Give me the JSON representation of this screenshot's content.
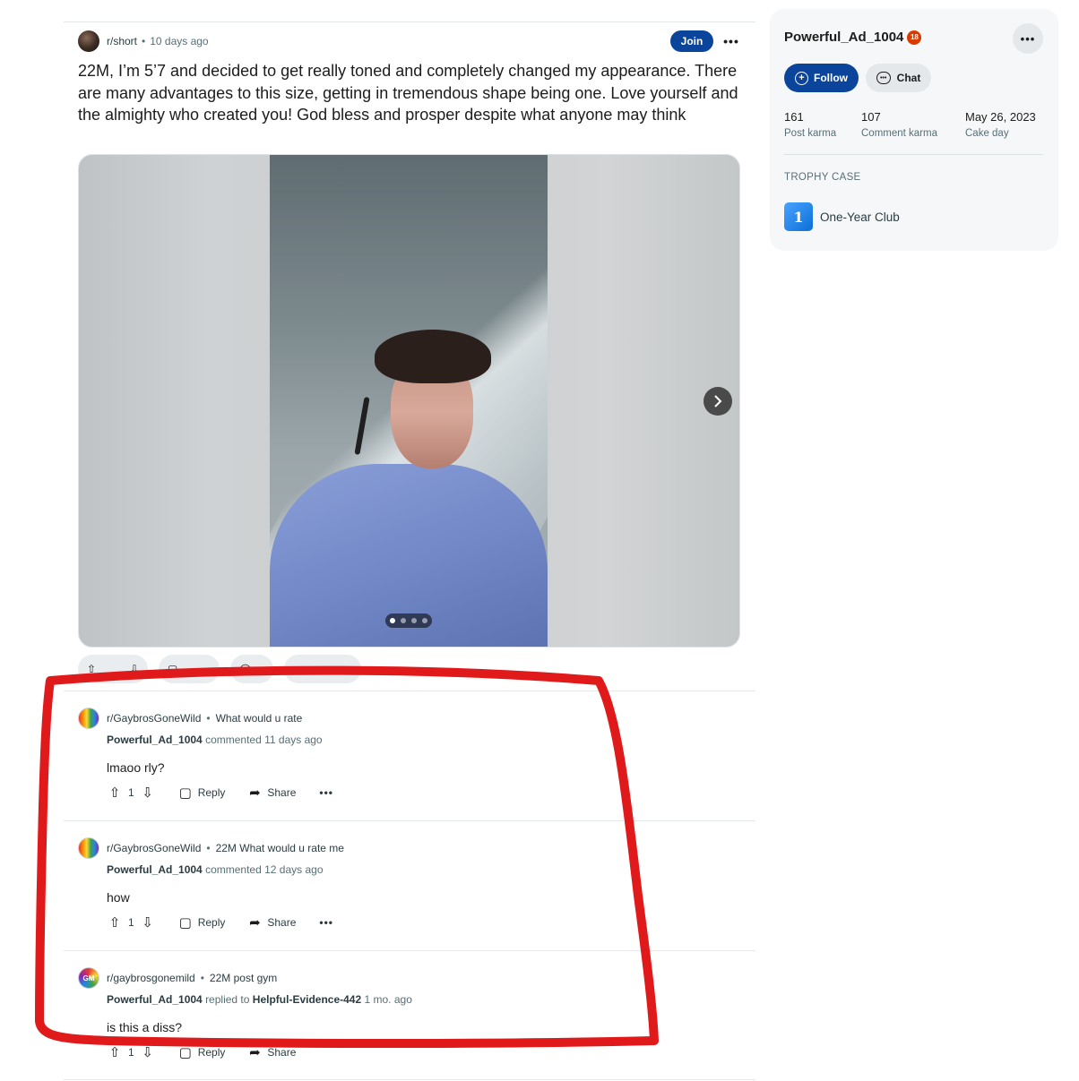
{
  "post": {
    "subreddit": "r/short",
    "age": "10 days ago",
    "join_label": "Join",
    "more_label": "•••",
    "title": "22M, I’m 5’7 and decided to get really toned and completely changed my appearance. There are many advantages to this size, getting in tremendous shape being one. Love yourself and the almighty who created you! God bless and prosper despite what anyone may think",
    "gallery": {
      "current": 1,
      "total": 4
    },
    "next_icon": "chevron-right-icon"
  },
  "comments": [
    {
      "subreddit": "r/GaybrosGoneWild",
      "post_title": "What would u rate",
      "author": "Powerful_Ad_1004",
      "action": "commented",
      "target": "",
      "age": "11 days ago",
      "body": "lmaoo rly?",
      "score": "1",
      "reply_label": "Reply",
      "share_label": "Share"
    },
    {
      "subreddit": "r/GaybrosGoneWild",
      "post_title": "22M What would u rate me",
      "author": "Powerful_Ad_1004",
      "action": "commented",
      "target": "",
      "age": "12 days ago",
      "body": "how",
      "score": "1",
      "reply_label": "Reply",
      "share_label": "Share"
    },
    {
      "subreddit": "r/gaybrosgonemild",
      "post_title": "22M post gym",
      "author": "Powerful_Ad_1004",
      "action": "replied to",
      "target": "Helpful-Evidence-442",
      "age": "1 mo. ago",
      "body": "is this a diss?",
      "score": "1",
      "reply_label": "Reply",
      "share_label": "Share"
    }
  ],
  "sidebar": {
    "username": "Powerful_Ad_1004",
    "badge": "18",
    "follow_label": "Follow",
    "chat_label": "Chat",
    "stats": [
      {
        "value": "161",
        "label": "Post karma"
      },
      {
        "value": "107",
        "label": "Comment karma"
      },
      {
        "value": "May 26, 2023",
        "label": "Cake day"
      }
    ],
    "trophy_heading": "TROPHY CASE",
    "trophies": [
      {
        "name": "One-Year Club",
        "icon": "one-year-club-icon"
      }
    ]
  },
  "colors": {
    "accent": "#0a449b",
    "annotation": "#e0191b",
    "nsfw": "#d93a00"
  }
}
